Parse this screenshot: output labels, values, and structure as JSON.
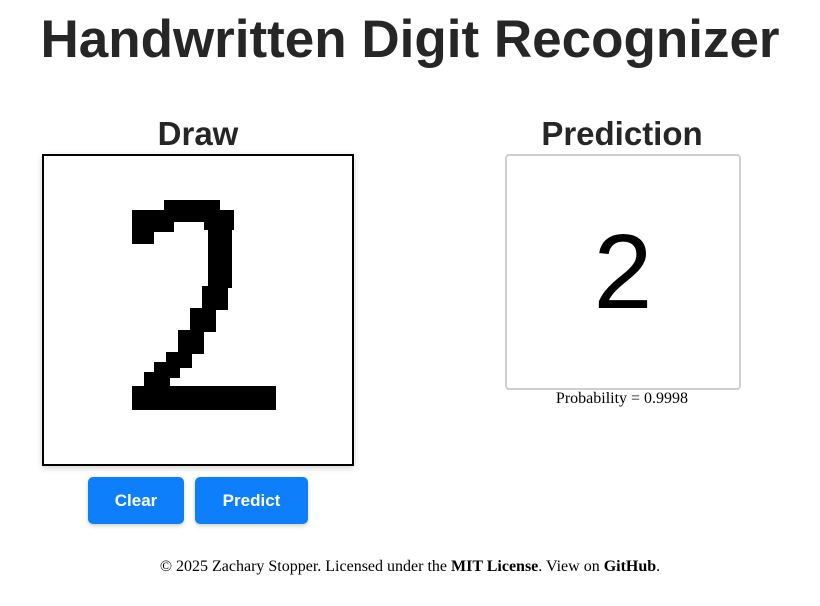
{
  "header": {
    "title": "Handwritten Digit Recognizer"
  },
  "draw_panel": {
    "heading": "Draw",
    "ink_color": "#000000",
    "clear_label": "Clear",
    "predict_label": "Predict",
    "button_color": "#0d7ffb"
  },
  "prediction_panel": {
    "heading": "Prediction",
    "digit": "2",
    "probability_text": "Probability = 0.9998"
  },
  "footer": {
    "copyright": "© 2025 Zachary Stopper. Licensed under the ",
    "license_link": "MIT License",
    "middle": ". View on ",
    "github_link": "GitHub",
    "end": "."
  }
}
